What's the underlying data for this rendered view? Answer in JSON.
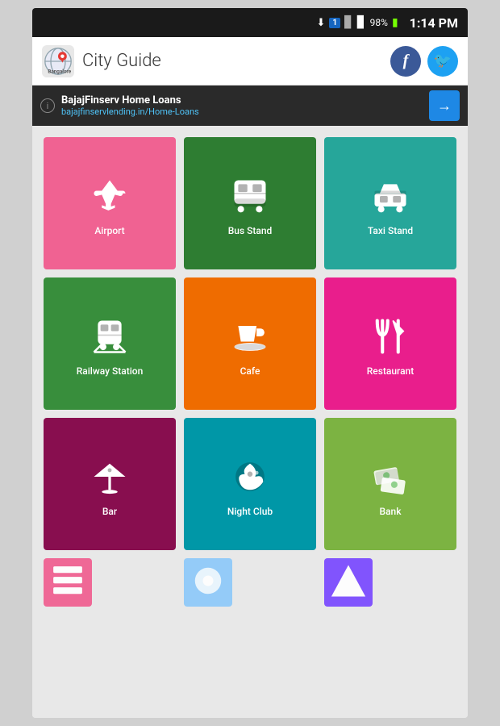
{
  "status_bar": {
    "time": "1:14 PM",
    "battery": "98%",
    "icons": [
      "wifi",
      "sim1",
      "signal1",
      "signal2",
      "battery"
    ]
  },
  "header": {
    "title": "City Guide",
    "facebook_label": "f",
    "twitter_label": "t"
  },
  "ad": {
    "title": "BajajFinserv Home Loans",
    "url": "bajajfinservlending.in/Home-Loans",
    "info": "i",
    "arrow": "→"
  },
  "grid": {
    "items": [
      {
        "id": "airport",
        "label": "Airport",
        "color": "#f06292",
        "icon": "airport"
      },
      {
        "id": "bus-stand",
        "label": "Bus Stand",
        "color": "#2e7d32",
        "icon": "bus"
      },
      {
        "id": "taxi-stand",
        "label": "Taxi Stand",
        "color": "#26a69a",
        "icon": "taxi"
      },
      {
        "id": "railway-station",
        "label": "Railway Station",
        "color": "#388e3c",
        "icon": "train"
      },
      {
        "id": "cafe",
        "label": "Cafe",
        "color": "#ef6c00",
        "icon": "cafe"
      },
      {
        "id": "restaurant",
        "label": "Restaurant",
        "color": "#e91e8c",
        "icon": "restaurant"
      },
      {
        "id": "bar",
        "label": "Bar",
        "color": "#880e4f",
        "icon": "bar"
      },
      {
        "id": "night-club",
        "label": "Night Club",
        "color": "#0097a7",
        "icon": "nightclub"
      },
      {
        "id": "bank",
        "label": "Bank",
        "color": "#7cb342",
        "icon": "bank"
      },
      {
        "id": "partial1",
        "label": "",
        "color": "#f06292",
        "icon": "partial1",
        "partial": true
      },
      {
        "id": "partial2",
        "label": "",
        "color": "#90caf9",
        "icon": "partial2",
        "partial": true
      },
      {
        "id": "partial3",
        "label": "",
        "color": "#7c4dff",
        "icon": "partial3",
        "partial": true
      }
    ]
  }
}
